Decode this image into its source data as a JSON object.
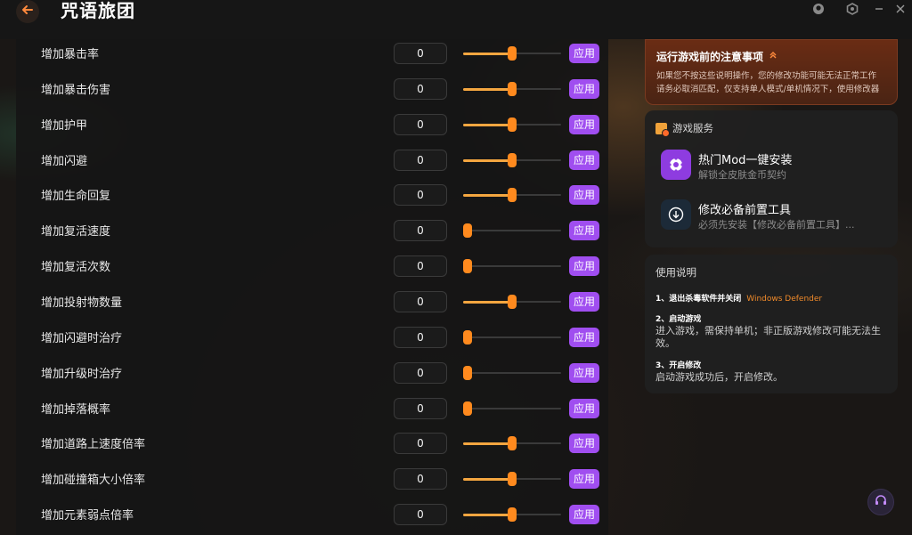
{
  "window": {
    "title": "咒语旅团"
  },
  "accent": {
    "slider_fill": "#f4a640",
    "slider_thumb": "#ff8a1e",
    "apply_button": "#a04ef0",
    "link_orange": "#f08a2a"
  },
  "cheats": [
    {
      "label": "增加暴击率",
      "value": "0",
      "slider_level": 0.5,
      "apply": "应用"
    },
    {
      "label": "增加暴击伤害",
      "value": "0",
      "slider_level": 0.5,
      "apply": "应用"
    },
    {
      "label": "增加护甲",
      "value": "0",
      "slider_level": 0.5,
      "apply": "应用"
    },
    {
      "label": "增加闪避",
      "value": "0",
      "slider_level": 0.5,
      "apply": "应用"
    },
    {
      "label": "增加生命回复",
      "value": "0",
      "slider_level": 0.5,
      "apply": "应用"
    },
    {
      "label": "增加复活速度",
      "value": "0",
      "slider_level": 0.0,
      "apply": "应用"
    },
    {
      "label": "增加复活次数",
      "value": "0",
      "slider_level": 0.0,
      "apply": "应用"
    },
    {
      "label": "增加投射物数量",
      "value": "0",
      "slider_level": 0.5,
      "apply": "应用"
    },
    {
      "label": "增加闪避时治疗",
      "value": "0",
      "slider_level": 0.0,
      "apply": "应用"
    },
    {
      "label": "增加升级时治疗",
      "value": "0",
      "slider_level": 0.0,
      "apply": "应用"
    },
    {
      "label": "增加掉落概率",
      "value": "0",
      "slider_level": 0.0,
      "apply": "应用"
    },
    {
      "label": "增加道路上速度倍率",
      "value": "0",
      "slider_level": 0.5,
      "apply": "应用"
    },
    {
      "label": "增加碰撞箱大小倍率",
      "value": "0",
      "slider_level": 0.5,
      "apply": "应用"
    },
    {
      "label": "增加元素弱点倍率",
      "value": "0",
      "slider_level": 0.5,
      "apply": "应用"
    }
  ],
  "notice": {
    "title": "运行游戏前的注意事项",
    "line1": "如果您不按这些说明操作，您的修改功能可能无法正常工作",
    "line2": "请务必取消匹配，仅支持单人模式/单机情况下，使用修改器"
  },
  "service": {
    "heading": "游戏服务",
    "items": [
      {
        "title": "热门Mod一键安装",
        "subtitle": "解锁全皮肤金币契约"
      },
      {
        "title": "修改必备前置工具",
        "subtitle": "必须先安装【修改必备前置工具】..."
      }
    ]
  },
  "usage": {
    "title": "使用说明",
    "steps": [
      {
        "head": "1、退出杀毒软件并关闭",
        "highlight": "Windows Defender",
        "body": ""
      },
      {
        "head": "2、启动游戏",
        "highlight": "",
        "body": "进入游戏，需保持单机；非正版游戏修改可能无法生效。"
      },
      {
        "head": "3、开启修改",
        "highlight": "",
        "body": "启动游戏成功后，开启修改。"
      }
    ]
  },
  "icons": {
    "back": "back-arrow-icon",
    "notice_toggle": "chevron-up-icon",
    "service": "box-icon",
    "mod": "mod-gear-icon",
    "tool": "download-icon",
    "support": "headset-icon",
    "account": "user-icon",
    "settings": "settings-icon",
    "minimize": "minimize-icon",
    "close": "close-icon"
  }
}
